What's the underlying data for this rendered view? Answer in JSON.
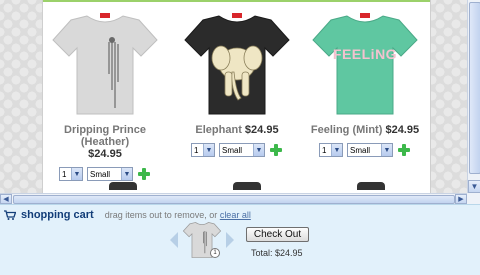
{
  "products": [
    {
      "name": "Dripping Prince (Heather)",
      "price": "$24.95",
      "qty": "1",
      "size": "Small",
      "shirt_color": "#d9d9d9",
      "art": "drips"
    },
    {
      "name": "Elephant",
      "price": "$24.95",
      "qty": "1",
      "size": "Small",
      "shirt_color": "#2b2b2b",
      "art": "elephant"
    },
    {
      "name": "Feeling (Mint)",
      "price": "$24.95",
      "qty": "1",
      "size": "Small",
      "shirt_color": "#5fc7a1",
      "art_text": "FEELiNG"
    }
  ],
  "cart": {
    "title": "shopping cart",
    "hint": "drag items out to remove, or",
    "clear_label": "clear all",
    "checkout_label": "Check Out",
    "total_label": "Total:",
    "total_value": "$24.95",
    "item_count": "1"
  },
  "colors": {
    "accent_green": "#3db84b",
    "cart_bg": "#e2f1fb",
    "cart_title": "#123d78"
  }
}
